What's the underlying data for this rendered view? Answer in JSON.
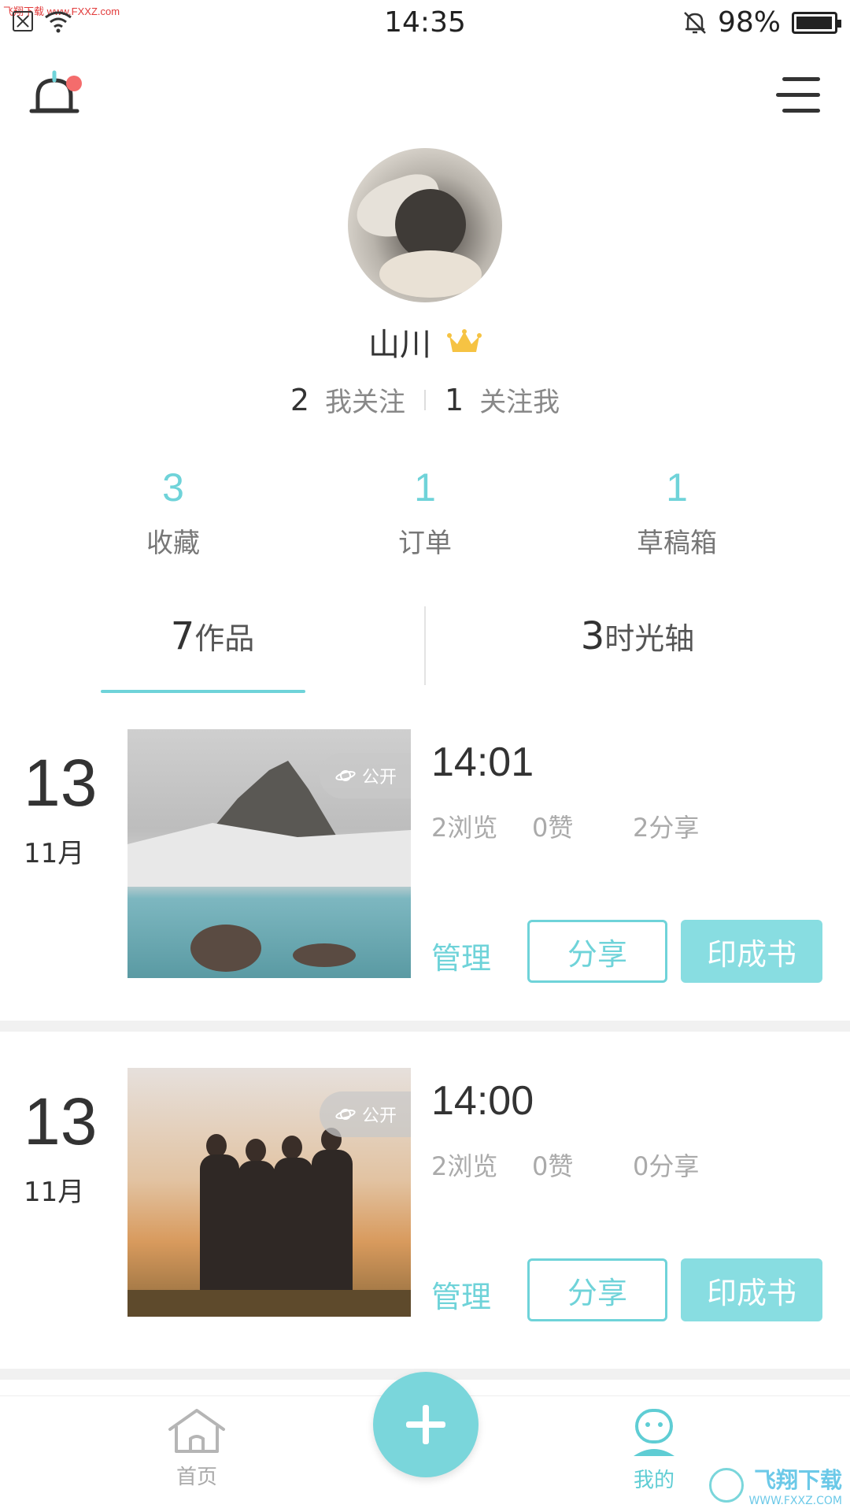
{
  "status_bar": {
    "watermark_url": "飞翔下载 www.FXXZ.com",
    "time": "14:35",
    "battery": "98%",
    "battery_level": 0.98
  },
  "header": {
    "bell_icon": "bell-icon",
    "menu_icon": "menu-icon",
    "has_notification_dot": true
  },
  "profile": {
    "username": "山川",
    "badge_icon": "crown-icon",
    "following_count": "2",
    "following_label": "我关注",
    "followers_count": "1",
    "followers_label": "关注我"
  },
  "stats": [
    {
      "count": "3",
      "label": "收藏"
    },
    {
      "count": "1",
      "label": "订单"
    },
    {
      "count": "1",
      "label": "草稿箱"
    }
  ],
  "tabs": [
    {
      "count": "7",
      "label": "作品",
      "active": true
    },
    {
      "count": "3",
      "label": "时光轴",
      "active": false
    }
  ],
  "works": [
    {
      "day": "13",
      "month": "11月",
      "visibility": "公开",
      "time": "14:01",
      "views": "2浏览",
      "likes": "0赞",
      "shares": "2分享",
      "manage": "管理",
      "share_button": "分享",
      "print_button": "印成书"
    },
    {
      "day": "13",
      "month": "11月",
      "visibility": "公开",
      "time": "14:00",
      "views": "2浏览",
      "likes": "0赞",
      "shares": "0分享",
      "manage": "管理",
      "share_button": "分享",
      "print_button": "印成书"
    }
  ],
  "bottom_nav": {
    "home_label": "首页",
    "mine_label": "我的",
    "add_icon": "plus-icon"
  },
  "watermark": {
    "title": "飞翔下载",
    "subtitle": "WWW.FXXZ.COM"
  },
  "colors": {
    "accent": "#6fd3d9",
    "accent_fill": "#88dde1",
    "text_dark": "#333333",
    "text_muted": "#aaaaaa"
  }
}
